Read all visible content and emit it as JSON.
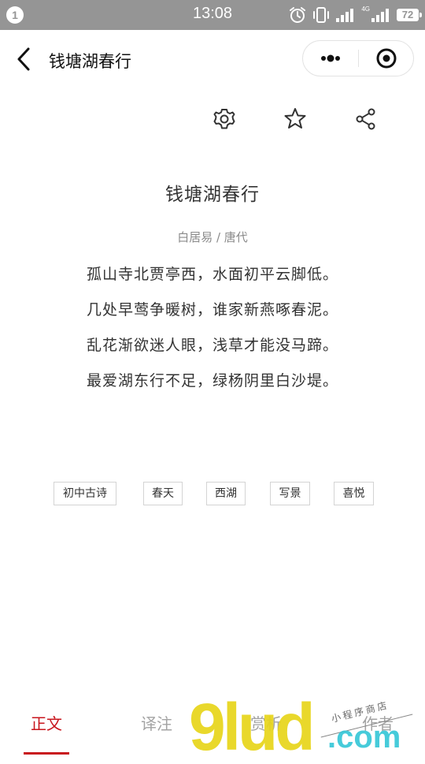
{
  "status_bar": {
    "notification_count": "1",
    "time": "13:08",
    "network_label": "4G",
    "battery": "72",
    "icons": [
      "alarm-icon",
      "vibrate-icon",
      "signal-icon",
      "signal-icon",
      "battery-icon"
    ]
  },
  "nav": {
    "title": "钱塘湖春行",
    "back_icon": "chevron-left-icon",
    "more_icon": "more-dots-icon",
    "close_icon": "target-icon"
  },
  "toolbar": {
    "icons": [
      "gear-icon",
      "star-icon",
      "share-icon"
    ]
  },
  "poem": {
    "title": "钱塘湖春行",
    "author_dynasty": "白居易 / 唐代",
    "lines": [
      "孤山寺北贾亭西，水面初平云脚低。",
      "几处早莺争暖树，谁家新燕啄春泥。",
      "乱花渐欲迷人眼，浅草才能没马蹄。",
      "最爱湖东行不足，绿杨阴里白沙堤。"
    ]
  },
  "tags": [
    "初中古诗",
    "春天",
    "西湖",
    "写景",
    "喜悦"
  ],
  "tabs": [
    {
      "label": "正文",
      "active": true
    },
    {
      "label": "译注",
      "active": false
    },
    {
      "label": "赏析",
      "active": false
    },
    {
      "label": "作者",
      "active": false
    }
  ],
  "watermark": {
    "brand": "9lud",
    "tld": ".com",
    "slogan": "小程序商店"
  },
  "colors": {
    "accent": "#c8161d",
    "status_bar": "#959595",
    "tab_inactive": "#a3a3a3",
    "watermark_yellow": "#e8d51a",
    "watermark_cyan": "#32c6d6"
  }
}
